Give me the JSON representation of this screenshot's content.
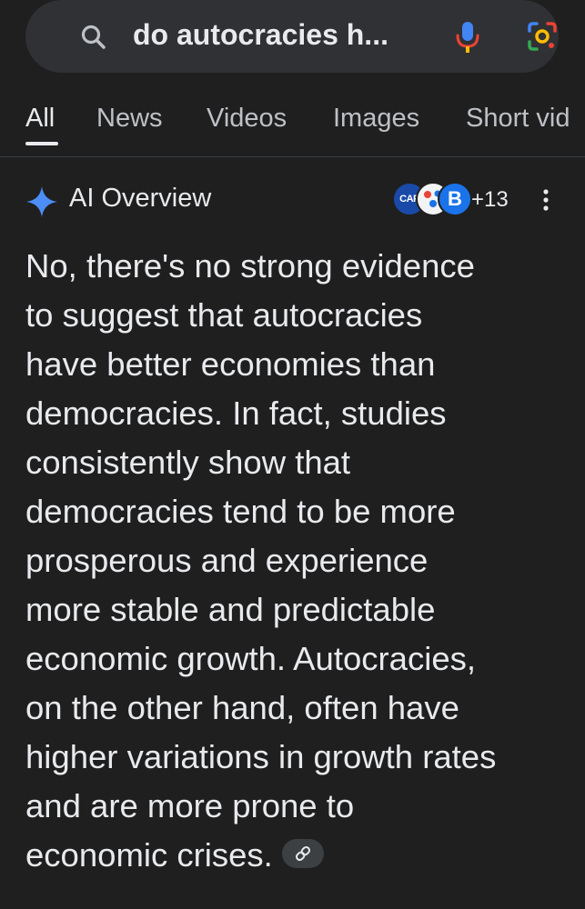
{
  "search": {
    "query": "do autocracies h...",
    "icons": {
      "search": "search-icon",
      "mic": "mic-icon",
      "lens": "lens-icon"
    },
    "colors": {
      "background": "#303134",
      "mic_blue": "#4285f4",
      "mic_red": "#ea4335",
      "mic_yellow": "#fbbc04",
      "mic_green": "#34a853"
    }
  },
  "tabs": [
    {
      "label": "All",
      "active": true
    },
    {
      "label": "News",
      "active": false
    },
    {
      "label": "Videos",
      "active": false
    },
    {
      "label": "Images",
      "active": false
    },
    {
      "label": "Short vid",
      "active": false
    }
  ],
  "ai_overview": {
    "title": "AI Overview",
    "sparkle_icon": "sparkle-icon",
    "sources": {
      "logos": [
        "cap-logo",
        "dots-logo",
        "b-logo"
      ],
      "cap_text": "CAP",
      "b_text": "B",
      "count": "+13"
    },
    "more_icon": "more-vert-icon",
    "answer_lines": [
      "No, there's no strong evidence",
      "to suggest that autocracies",
      "have better economies than",
      "democracies. In fact, studies",
      "consistently show that",
      "democracies tend to be more",
      "prosperous and experience",
      "more stable and predictable",
      "economic growth. Autocracies,",
      "on the other hand, often have",
      "higher variations in growth rates",
      "and are more prone to",
      "economic crises."
    ],
    "link_icon": "link-icon"
  },
  "colors": {
    "page_bg": "#1f1f1f",
    "text": "#e8eaed",
    "muted": "#bdc1c6",
    "sparkle": "#4c8df6"
  }
}
